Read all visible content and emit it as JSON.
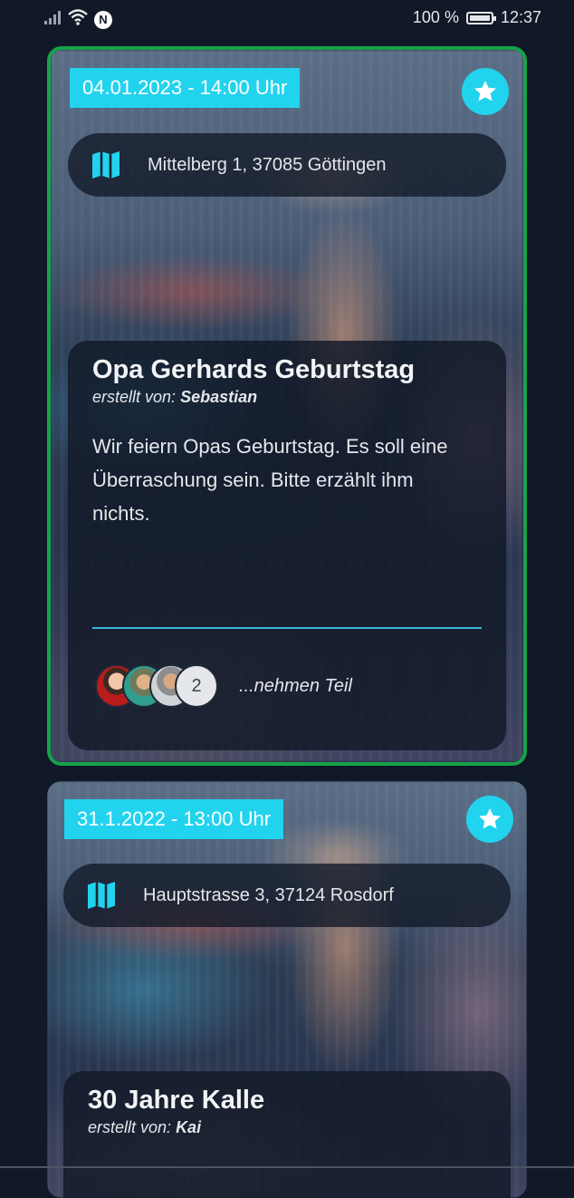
{
  "status_bar": {
    "nfc_label": "N",
    "battery_percent": "100 %",
    "time": "12:37"
  },
  "events": [
    {
      "date": "04.01.2023 - 14:00 Uhr",
      "address": "Mittelberg 1, 37085 Göttingen",
      "title": "Opa Gerhards Geburtstag",
      "creator_prefix": "erstellt von:",
      "creator_name": "Sebastian",
      "description": "Wir feiern Opas Geburtstag. Es soll eine Überraschung sein. Bitte erzählt ihm nichts.",
      "extra_participants": "2",
      "participants_label": "...nehmen Teil",
      "highlight_color": "#16a34a"
    },
    {
      "date": "31.1.2022 - 13:00 Uhr",
      "address": "Hauptstrasse 3, 37124 Rosdorf",
      "title": "30 Jahre Kalle",
      "creator_prefix": "erstellt von:",
      "creator_name": "Kai"
    }
  ],
  "colors": {
    "background": "#111827",
    "accent": "#22d3ee",
    "selected_border": "#16a34a"
  },
  "icons": {
    "favorite": "star-icon",
    "location": "map-icon"
  }
}
